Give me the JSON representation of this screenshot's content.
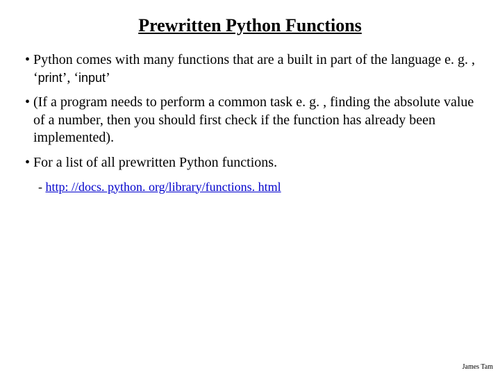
{
  "title": "Prewritten Python Functions",
  "bullets": {
    "b1_pre": "Python comes with many functions that are a built in part of the language e. g. , ‘",
    "b1_code1": "print",
    "b1_mid": "’, ‘",
    "b1_code2": "input",
    "b1_post": "’",
    "b2": "(If a program needs to perform a common task e. g. , finding the absolute value of a number, then you should first check if the function has already been implemented).",
    "b3": "For a list of all prewritten Python functions."
  },
  "link": "http: //docs. python. org/library/functions. html",
  "footer": "James Tam"
}
